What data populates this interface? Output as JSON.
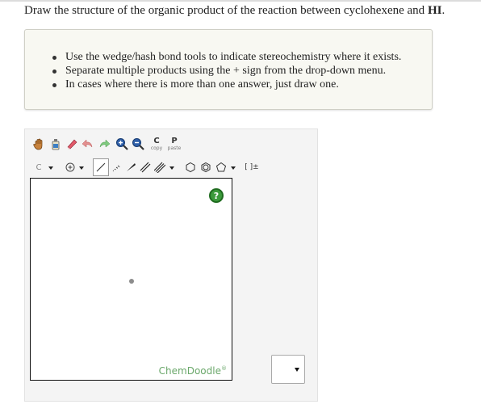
{
  "question": {
    "prefix": "Draw the structure of the organic product of the reaction between cyclohexene and ",
    "reagent": "HI",
    "suffix": "."
  },
  "instructions": [
    "Use the wedge/hash bond tools to indicate stereochemistry where it exists.",
    "Separate multiple products using the + sign from the drop-down menu.",
    "In cases where there is more than one answer, just draw one."
  ],
  "toolbar": {
    "copy_label": "copy",
    "copy_letter": "C",
    "paste_label": "paste",
    "paste_letter": "P",
    "element_label": "C",
    "bracket_label": "[ ]±"
  },
  "editor": {
    "help_label": "?",
    "brand": "ChemDoodle",
    "brand_mark": "®"
  },
  "colors": {
    "help_green": "#3b9a3b",
    "brand_green": "#6ba86b"
  }
}
